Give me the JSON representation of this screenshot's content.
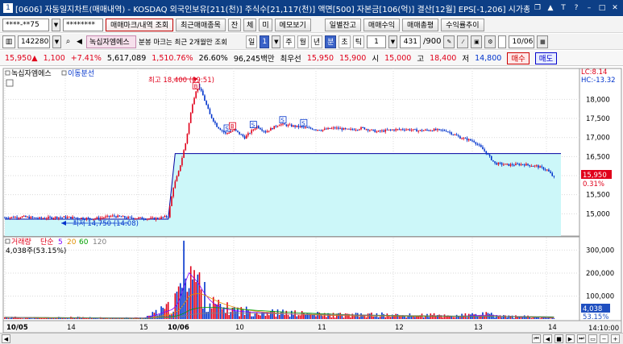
{
  "window": {
    "title": "[0606] 자동일지차트(매매내역) - KOSDAQ 외국인보유[211(천)] 주식수[21,117(천)] 액면[500] 자본금[106(억)] 결산[12월] EPS[-1,206] 시가총액[",
    "app_icon": "1"
  },
  "toolbar1": {
    "account": "****-**75",
    "password": "********",
    "trade_mark_btn": "매매마크/내역 조회",
    "recent_btn": "최근매매종목",
    "jan_btn": "잔",
    "che_btn": "체",
    "mi_btn": "미",
    "memo_btn": "메모보기",
    "daily_btn": "일별잔고",
    "profit_btn": "매매수익",
    "summary_btn": "매매총평",
    "yield_btn": "수익률추이"
  },
  "toolbar2": {
    "code": "142280",
    "stock_name": "녹십자엠에스",
    "notice": "분봉 마크는 최근 2개월만 조회",
    "periods": [
      "일",
      "1",
      "주",
      "월",
      "년",
      "분",
      "초",
      "틱"
    ],
    "active_period": "분",
    "interval_value": "1",
    "count": "431",
    "count_total": "/900",
    "date": "10/06"
  },
  "infobar": {
    "price": "15,950",
    "change": "1,100",
    "change_pct": "+7.41%",
    "volume": "5,617,089",
    "volume_ratio": "1,510.76%",
    "turnover": "26.60%",
    "amount": "96,245백만",
    "best_bid_label": "최우선",
    "best_ask": "15,950",
    "best_bid": "15,900",
    "open_label": "시",
    "open": "15,000",
    "high_label": "고",
    "high": "18,400",
    "low_label": "저",
    "low": "14,800",
    "buy_btn": "매수",
    "sell_btn": "매도"
  },
  "price_panel": {
    "legend_name": "녹십자엠에스",
    "legend_ma": "이동분선",
    "lc_label": "LC:8.14",
    "hc_label": "HC:-13.32",
    "max_label": "최고 18,400 (09:51)",
    "min_label": "최저 14,750 (14:08)",
    "current_price": "15,950",
    "current_pct": "0.31%"
  },
  "volume_panel": {
    "legend_volume": "거래량",
    "legend_simple": "단순",
    "ma1": "5",
    "ma2": "20",
    "ma3": "60",
    "ma4": "120",
    "current_volume_label": "4,038주(53.15%)",
    "current_volume": "4,038",
    "current_pct": "53.15%"
  },
  "status": {
    "time": "14:10:00"
  },
  "colors": {
    "up": "#e0001a",
    "down": "#0033cc",
    "avg_fill": "#ccf7f9",
    "avg_line": "#0000a0"
  },
  "icons": {
    "search": "search-icon",
    "dropdown": "chevron-down-icon",
    "calendar": "calendar-icon",
    "settings": "gear-icon",
    "save": "save-icon"
  },
  "chart_data": {
    "type": "candlestick",
    "interval": "1-minute",
    "y_ticks": [
      15000,
      15500,
      16000,
      16500,
      17000,
      17500,
      18000
    ],
    "volume_ticks": [
      "100,000",
      "200,000",
      "300,000"
    ],
    "x_ticks": [
      "10/05",
      "14",
      "15",
      "10/06",
      "10",
      "11",
      "12",
      "13",
      "14"
    ],
    "high": 18400,
    "low": 14750,
    "last": 15950,
    "average_price_step": {
      "before": 14860,
      "after": 16580
    },
    "price_path": [
      [
        0,
        14900
      ],
      [
        10,
        14920
      ],
      [
        20,
        14880
      ],
      [
        30,
        14910
      ],
      [
        40,
        14900
      ],
      [
        50,
        14870
      ],
      [
        55,
        14890
      ],
      [
        62,
        14940
      ],
      [
        70,
        14900
      ],
      [
        80,
        14880
      ],
      [
        86,
        14870
      ],
      [
        90,
        14900
      ],
      [
        94,
        14930
      ],
      [
        97,
        15700
      ],
      [
        100,
        16100
      ],
      [
        104,
        16850
      ],
      [
        108,
        17900
      ],
      [
        111,
        18400
      ],
      [
        114,
        18100
      ],
      [
        118,
        17600
      ],
      [
        122,
        17300
      ],
      [
        127,
        17100
      ],
      [
        132,
        17200
      ],
      [
        138,
        17000
      ],
      [
        145,
        17300
      ],
      [
        150,
        17150
      ],
      [
        158,
        17350
      ],
      [
        166,
        17300
      ],
      [
        174,
        17250
      ],
      [
        182,
        17200
      ],
      [
        190,
        17250
      ],
      [
        198,
        17200
      ],
      [
        206,
        17250
      ],
      [
        214,
        17150
      ],
      [
        222,
        17200
      ],
      [
        230,
        17220
      ],
      [
        238,
        17180
      ],
      [
        246,
        17200
      ],
      [
        254,
        17180
      ],
      [
        262,
        17000
      ],
      [
        270,
        16900
      ],
      [
        276,
        16650
      ],
      [
        282,
        16320
      ],
      [
        290,
        16280
      ],
      [
        298,
        16300
      ],
      [
        306,
        16250
      ],
      [
        312,
        16150
      ],
      [
        316,
        15950
      ]
    ],
    "volume_bars": [
      [
        0,
        8
      ],
      [
        20,
        6
      ],
      [
        40,
        7
      ],
      [
        60,
        5
      ],
      [
        80,
        6
      ],
      [
        97,
        60
      ],
      [
        100,
        120
      ],
      [
        103,
        240
      ],
      [
        106,
        300
      ],
      [
        108,
        210
      ],
      [
        111,
        180
      ],
      [
        114,
        120
      ],
      [
        118,
        80
      ],
      [
        122,
        60
      ],
      [
        127,
        50
      ],
      [
        135,
        40
      ],
      [
        145,
        35
      ],
      [
        155,
        30
      ],
      [
        170,
        25
      ],
      [
        185,
        20
      ],
      [
        200,
        18
      ],
      [
        215,
        20
      ],
      [
        230,
        16
      ],
      [
        245,
        18
      ],
      [
        260,
        15
      ],
      [
        275,
        22
      ],
      [
        290,
        12
      ],
      [
        305,
        10
      ],
      [
        316,
        4
      ]
    ],
    "marks": [
      {
        "x": 110,
        "label": "B",
        "color": "red"
      },
      {
        "x": 128,
        "label": "S",
        "color": "blue"
      },
      {
        "x": 131,
        "label": "B",
        "color": "red"
      },
      {
        "x": 143,
        "label": "S",
        "color": "blue"
      },
      {
        "x": 160,
        "label": "S",
        "color": "blue"
      },
      {
        "x": 172,
        "label": "S",
        "color": "blue"
      }
    ]
  }
}
